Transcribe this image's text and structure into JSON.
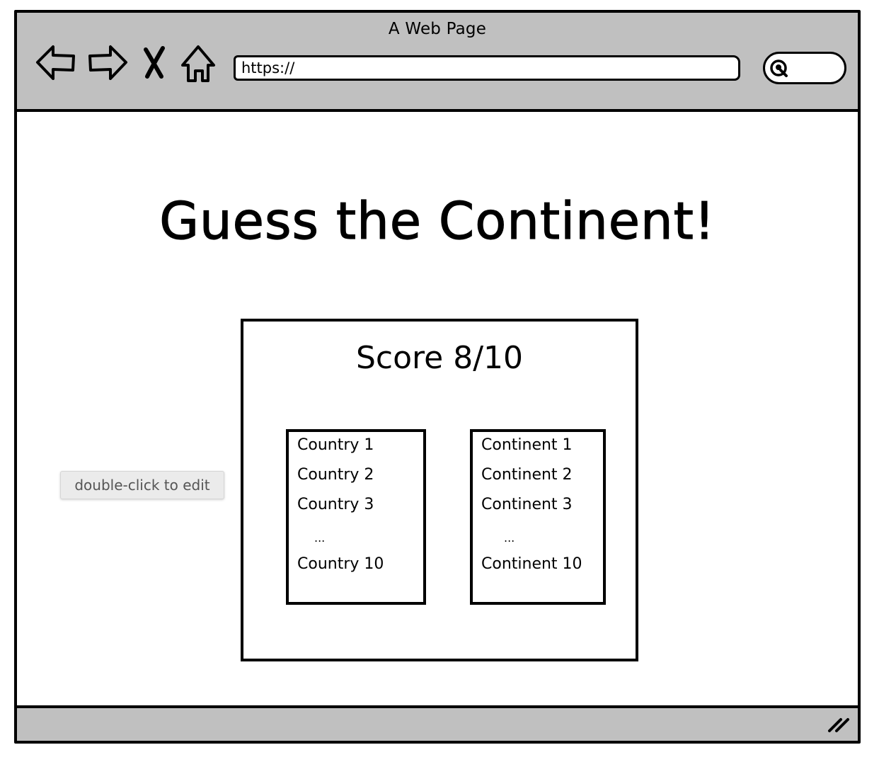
{
  "window": {
    "title": "A Web Page"
  },
  "toolbar": {
    "buttons": [
      {
        "name": "back",
        "icon": "arrow-left-icon"
      },
      {
        "name": "forward",
        "icon": "arrow-right-icon"
      },
      {
        "name": "stop",
        "icon": "close-icon"
      },
      {
        "name": "home",
        "icon": "home-icon"
      }
    ],
    "url": "https://",
    "search_icon": "search-icon"
  },
  "main": {
    "heading": "Guess the Continent!",
    "score_label": "Score 8/10",
    "countries": [
      "Country 1",
      "Country 2",
      "Country 3",
      "...",
      "Country 10"
    ],
    "continents": [
      "Continent 1",
      "Continent 2",
      "Continent 3",
      "...",
      "Continent 10"
    ]
  },
  "tooltip": {
    "text": "double-click to edit"
  },
  "colors": {
    "chrome": "#c0c0c0",
    "ink": "#000000",
    "tooltip_bg": "#ebebeb"
  }
}
